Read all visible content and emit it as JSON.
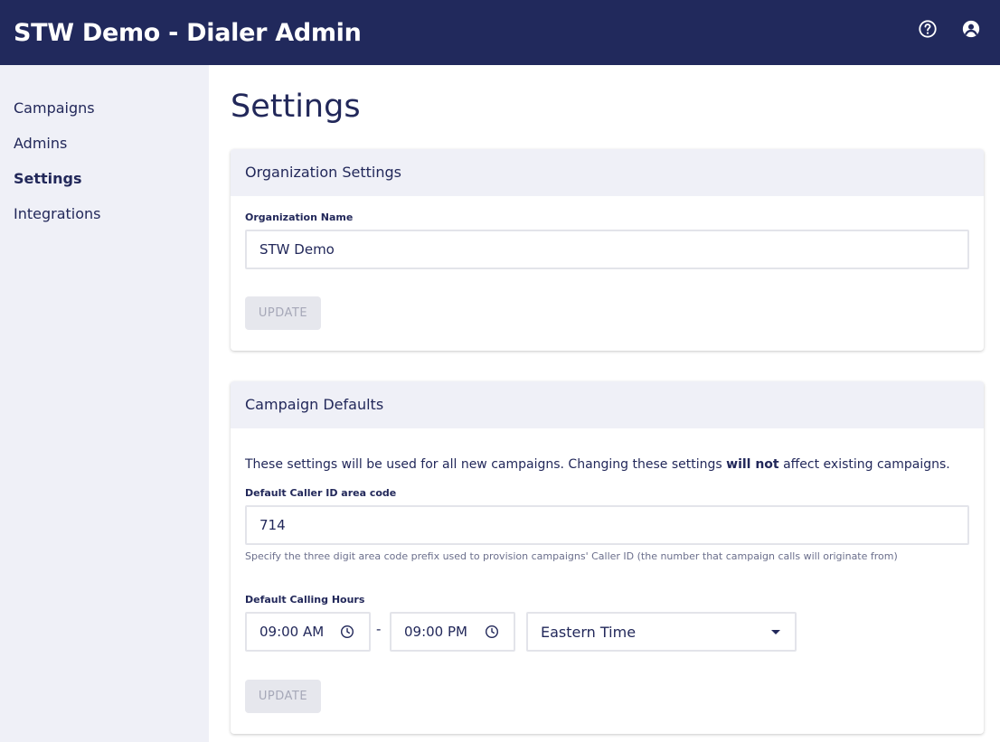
{
  "app": {
    "title": "STW Demo - Dialer Admin"
  },
  "topbar": {
    "icons": [
      "help-icon",
      "account-icon"
    ]
  },
  "sidebar": {
    "items": [
      {
        "label": "Campaigns",
        "active": false
      },
      {
        "label": "Admins",
        "active": false
      },
      {
        "label": "Settings",
        "active": true
      },
      {
        "label": "Integrations",
        "active": false
      }
    ]
  },
  "page": {
    "title": "Settings"
  },
  "org_settings": {
    "header": "Organization Settings",
    "name_label": "Organization Name",
    "name_value": "STW Demo",
    "update_label": "UPDATE"
  },
  "campaign_defaults": {
    "header": "Campaign Defaults",
    "desc_pre": "These settings will be used for all new campaigns. Changing these settings ",
    "desc_bold": "will not",
    "desc_post": " affect existing campaigns.",
    "caller_id_label": "Default Caller ID area code",
    "caller_id_value": "714",
    "caller_id_helper": "Specify the three digit area code prefix used to provision campaigns' Caller ID (the number that campaign calls will originate from)",
    "hours_label": "Default Calling Hours",
    "start_time": "09:00 AM",
    "separator": "-",
    "end_time": "09:00 PM",
    "timezone": "Eastern Time",
    "update_label": "UPDATE"
  },
  "colors": {
    "topbar": "#21295c",
    "sidebar": "#eff0f7",
    "text": "#22285a",
    "disabled_button": "#e6e7ed"
  }
}
